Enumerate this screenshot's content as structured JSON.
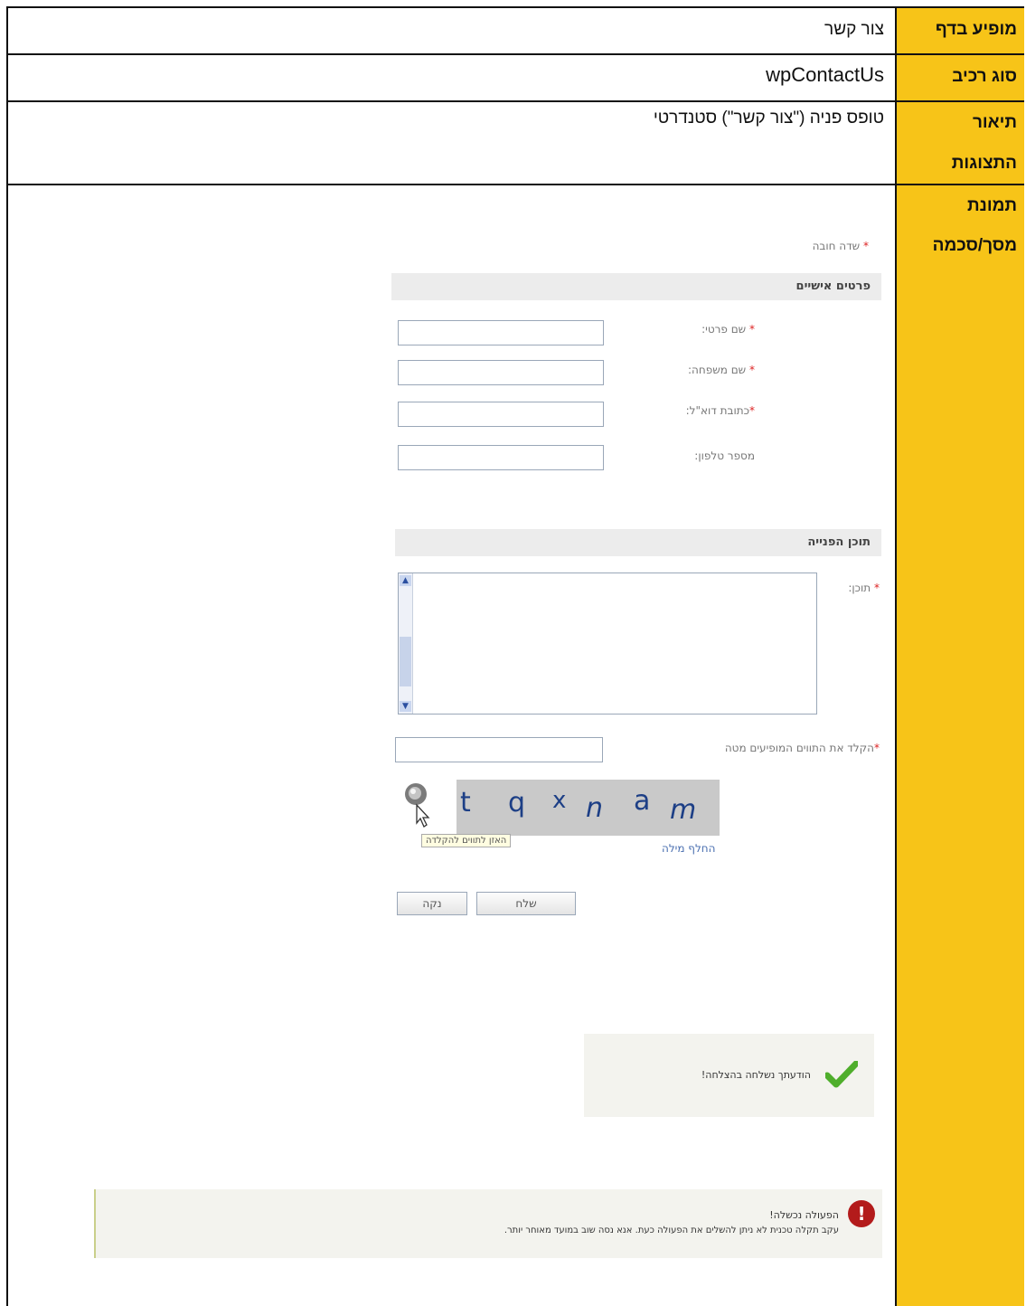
{
  "rows": [
    {
      "label": "מופיע בדף",
      "value": "צור קשר"
    },
    {
      "label": "סוג רכיב",
      "value": "wpContactUs"
    },
    {
      "label_lines": [
        "תיאור",
        "התצוגות"
      ],
      "value": "טופס פניה (\"צור קשר\") סטנדרטי"
    },
    {
      "label_lines": [
        "תמונת",
        "מסך/סכמה"
      ]
    }
  ],
  "form": {
    "required_note": "שדה חובה",
    "section_personal": "פרטים אישיים",
    "fields": [
      {
        "label": "שם פרטי:",
        "required": true
      },
      {
        "label": "שם משפחה:",
        "required": true
      },
      {
        "label": "כתובת דוא\"ל:",
        "required": true
      },
      {
        "label": "מספר טלפון:",
        "required": false
      }
    ],
    "section_content": "תוכן הפנייה",
    "content_label": "תוכן:",
    "captcha_label": "הקלד את התווים המופיעים מטה",
    "captcha_text": [
      "t",
      "q",
      "x",
      "n",
      "a",
      "m"
    ],
    "audio_tooltip": "האזן לתווים להקלדה",
    "change_word": "החלף מילה",
    "send_button": "שלח",
    "clear_button": "נקה"
  },
  "success_message": "הודעתך נשלחה בהצלחה!",
  "error_message": {
    "title": "הפעולה נכשלה!",
    "body": "עקב תקלה טכנית לא ניתן להשלים את הפעולה כעת. אנא נסה שוב במועד מאוחר יותר."
  },
  "colors": {
    "label_bg": "#f7c418",
    "border": "#111111",
    "captcha_text": "#1d3f86"
  }
}
